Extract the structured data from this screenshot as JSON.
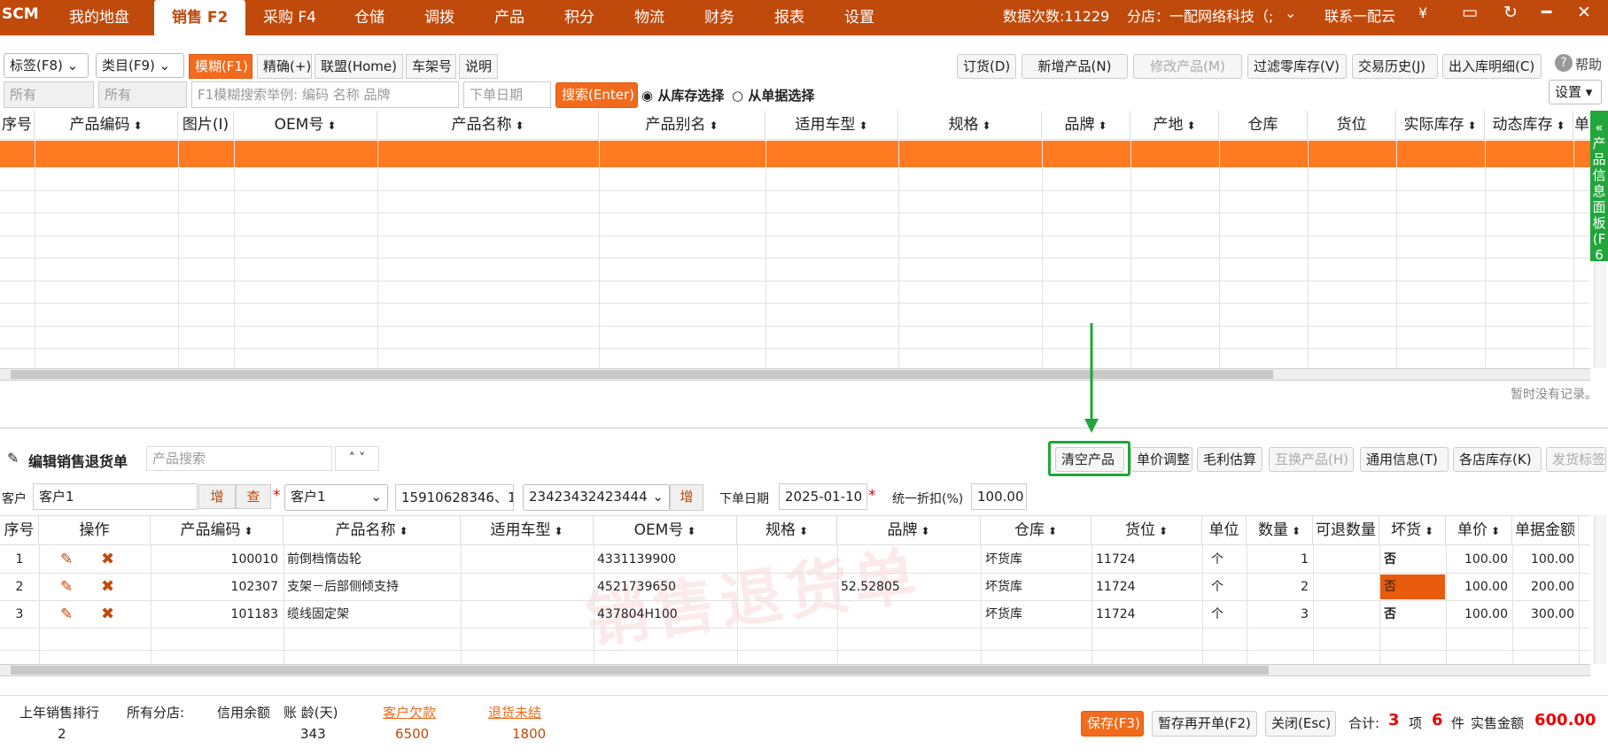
{
  "nav": {
    "logo": "SCM",
    "items": [
      "我的地盘",
      "销售 F2",
      "采购 F4",
      "仓储",
      "调拨",
      "产品",
      "积分",
      "物流",
      "财务",
      "报表",
      "设置"
    ],
    "data_count": "数据次数:11229",
    "branch": "分店：一配网络科技（;",
    "contact": "联系一配云",
    "yen": "¥"
  },
  "toolbar": {
    "tag": "标签(F8)",
    "category": "类目(F9)",
    "fuzzy": "模糊(F1)",
    "exact": "精确(+)",
    "alliance": "联盟(Home)",
    "frame": "车架号",
    "explain": "说明",
    "order": "订货(D)",
    "add_product": "新增产品(N)",
    "edit_product": "修改产品(M)",
    "filter_zero": "过滤零库存(V)",
    "history": "交易历史(J)",
    "inout": "出入库明细(C)",
    "help": "帮助",
    "settings": "设置",
    "all1": "所有",
    "all2": "所有",
    "search_placeholder": "F1模糊搜索举例: 编码 名称 品牌",
    "date_placeholder": "下单日期",
    "search_btn": "搜索(Enter)",
    "radio_stock": "从库存选择",
    "radio_bill": "从单据选择"
  },
  "top_grid": {
    "headers": [
      "序号",
      "产品编码",
      "图片(I)",
      "OEM号",
      "产品名称",
      "产品别名",
      "适用车型",
      "规格",
      "品牌",
      "产地",
      "仓库",
      "货位",
      "实际库存",
      "动态库存",
      "单"
    ],
    "empty_text": "暂时没有记录。"
  },
  "side_tab": "产品信息面板(F6",
  "edit": {
    "title": "编辑销售退货单",
    "search_placeholder": "产品搜索",
    "clear": "清空产品",
    "price_adjust": "单价调整",
    "gross": "毛利估算",
    "swap": "互换产品(H)",
    "general": "通用信息(T)",
    "stores": "各店库存(K)",
    "ship_tag": "发货标签"
  },
  "customer": {
    "label": "客户",
    "value": "客户1",
    "add": "增",
    "check": "查",
    "select": "客户1",
    "phone": "15910628346、1",
    "account": "23423432423444",
    "add2": "增",
    "date_label": "下单日期",
    "date": "2025-01-10",
    "discount_label": "统一折扣(%)",
    "discount": "100.00"
  },
  "bottom_grid": {
    "headers": [
      "序号",
      "操作",
      "产品编码",
      "产品名称",
      "适用车型",
      "OEM号",
      "规格",
      "品牌",
      "仓库",
      "货位",
      "单位",
      "数量",
      "可退数量",
      "坏货",
      "单价",
      "单据金额"
    ],
    "rows": [
      {
        "no": "1",
        "code": "100010",
        "name": "前倒档惰齿轮",
        "model": "",
        "oem": "4331139900",
        "spec": "",
        "brand": "",
        "wh": "坏货库",
        "loc": "11724",
        "unit": "个",
        "qty": "1",
        "ret": "",
        "bad": "否",
        "price": "100.00",
        "amount": "100.00"
      },
      {
        "no": "2",
        "code": "102307",
        "name": "支架－后部侧倾支持",
        "model": "",
        "oem": "4521739650",
        "spec": "",
        "brand": "52.52805",
        "wh": "坏货库",
        "loc": "11724",
        "unit": "个",
        "qty": "2",
        "ret": "",
        "bad": "否",
        "price": "100.00",
        "amount": "200.00"
      },
      {
        "no": "3",
        "code": "101183",
        "name": "缆线固定架",
        "model": "",
        "oem": "437804H100",
        "spec": "",
        "brand": "",
        "wh": "坏货库",
        "loc": "11724",
        "unit": "个",
        "qty": "3",
        "ret": "",
        "bad": "否",
        "price": "100.00",
        "amount": "300.00"
      }
    ],
    "watermark": "销售退货单"
  },
  "footer": {
    "rank_label": "上年销售排行",
    "rank_value": "2",
    "all_branches": "所有分店:",
    "credit_label": "信用余额",
    "aging_label": "账 龄(天)",
    "aging_value": "343",
    "debt_label": "客户欠款",
    "debt_value": "6500",
    "return_label": "退货未结",
    "return_value": "1800",
    "save": "保存(F3)",
    "save_new": "暂存再开单(F2)",
    "close": "关闭(Esc)",
    "total_label": "合计:",
    "items": "3",
    "items_unit": "项",
    "pieces": "6",
    "pieces_unit": "件",
    "sales_label": "实售金额",
    "sales_amount": "600.00"
  }
}
